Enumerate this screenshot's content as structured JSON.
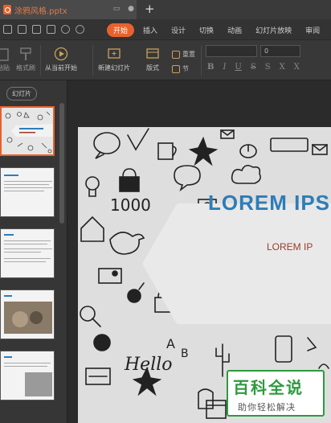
{
  "window": {
    "tab_title": "涂鸦风格.pptx"
  },
  "menu": {
    "items": [
      "开始",
      "插入",
      "设计",
      "切换",
      "动画",
      "幻灯片放映",
      "审阅"
    ],
    "active": "开始"
  },
  "ribbon": {
    "paste_label": "粘贴",
    "format_painter_label": "格式刷",
    "from_current_label": "从当前开始",
    "new_slide_label": "新建幻灯片",
    "layout_label": "版式",
    "reset_label": "重置",
    "section_label": "节",
    "font_size_value": "0"
  },
  "left_panel": {
    "tab_label": "幻灯片"
  },
  "slide": {
    "title": "LOREM IPS",
    "subtitle": "LOREM IP"
  },
  "watermark": {
    "main": "百科全说",
    "sub": "助你轻松解决"
  },
  "colors": {
    "accent": "#e8612c",
    "title_blue": "#2d7db8",
    "watermark_green": "#2e9a3e"
  }
}
